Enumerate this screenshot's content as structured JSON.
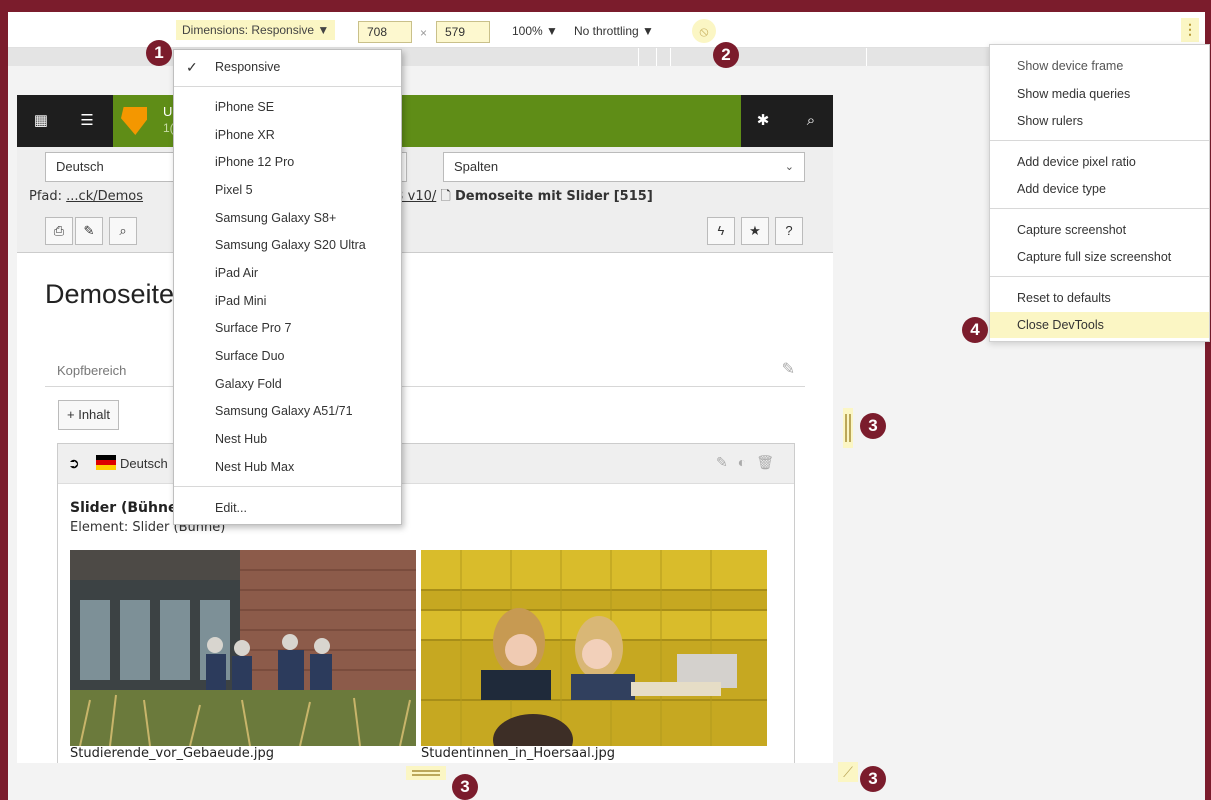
{
  "toolbar": {
    "dimensions_label": "Dimensions: Responsive ▼",
    "width_value": "708",
    "times": "×",
    "height_value": "579",
    "zoom": "100% ▼",
    "throttling": "No throttling ▼",
    "rotate_icon": "⦸",
    "more_icon": "⋮"
  },
  "dimensions_menu": {
    "check": "✓",
    "items": [
      "Responsive",
      "iPhone SE",
      "iPhone XR",
      "iPhone 12 Pro",
      "Pixel 5",
      "Samsung Galaxy S8+",
      "Samsung Galaxy S20 Ultra",
      "iPad Air",
      "iPad Mini",
      "Surface Pro 7",
      "Surface Duo",
      "Galaxy Fold",
      "Samsung Galaxy A51/71",
      "Nest Hub",
      "Nest Hub Max",
      "Edit..."
    ],
    "selected": "Responsive"
  },
  "more_menu": {
    "items": [
      "Show device frame",
      "Show media queries",
      "Show rulers",
      "Add device pixel ratio",
      "Add device type",
      "Capture screenshot",
      "Capture full size screenshot",
      "Reset to defaults",
      "Close DevTools"
    ],
    "highlighted": "Close DevTools"
  },
  "typo3": {
    "site_name": "U",
    "site_version": "1(",
    "language_select": "Deutsch",
    "view_select": "Spalten",
    "path_label": "Pfad:",
    "path_link1": "...ck/Demos",
    "path_link2": "TYPO3 v10/",
    "page_name": "Demoseite mit Slider [515]",
    "page_title": "Demoseite",
    "tab_label": "Kopfbereich",
    "add_content": "+ Inhalt",
    "element_language": "Deutsch",
    "element_title": "Slider (Bühne",
    "element_type": "Element: Slider (Bühne)",
    "image1_caption": "Studierende_vor_Gebaeude.jpg",
    "image2_caption": "Studentinnen_in_Hoersaal.jpg",
    "help": "?"
  },
  "callouts": [
    "1",
    "2",
    "3",
    "3",
    "3",
    "4"
  ],
  "colors": {
    "frame": "#7b1c2c",
    "typo3_green": "#5f8d17",
    "highlight": "#fbf6c4"
  }
}
